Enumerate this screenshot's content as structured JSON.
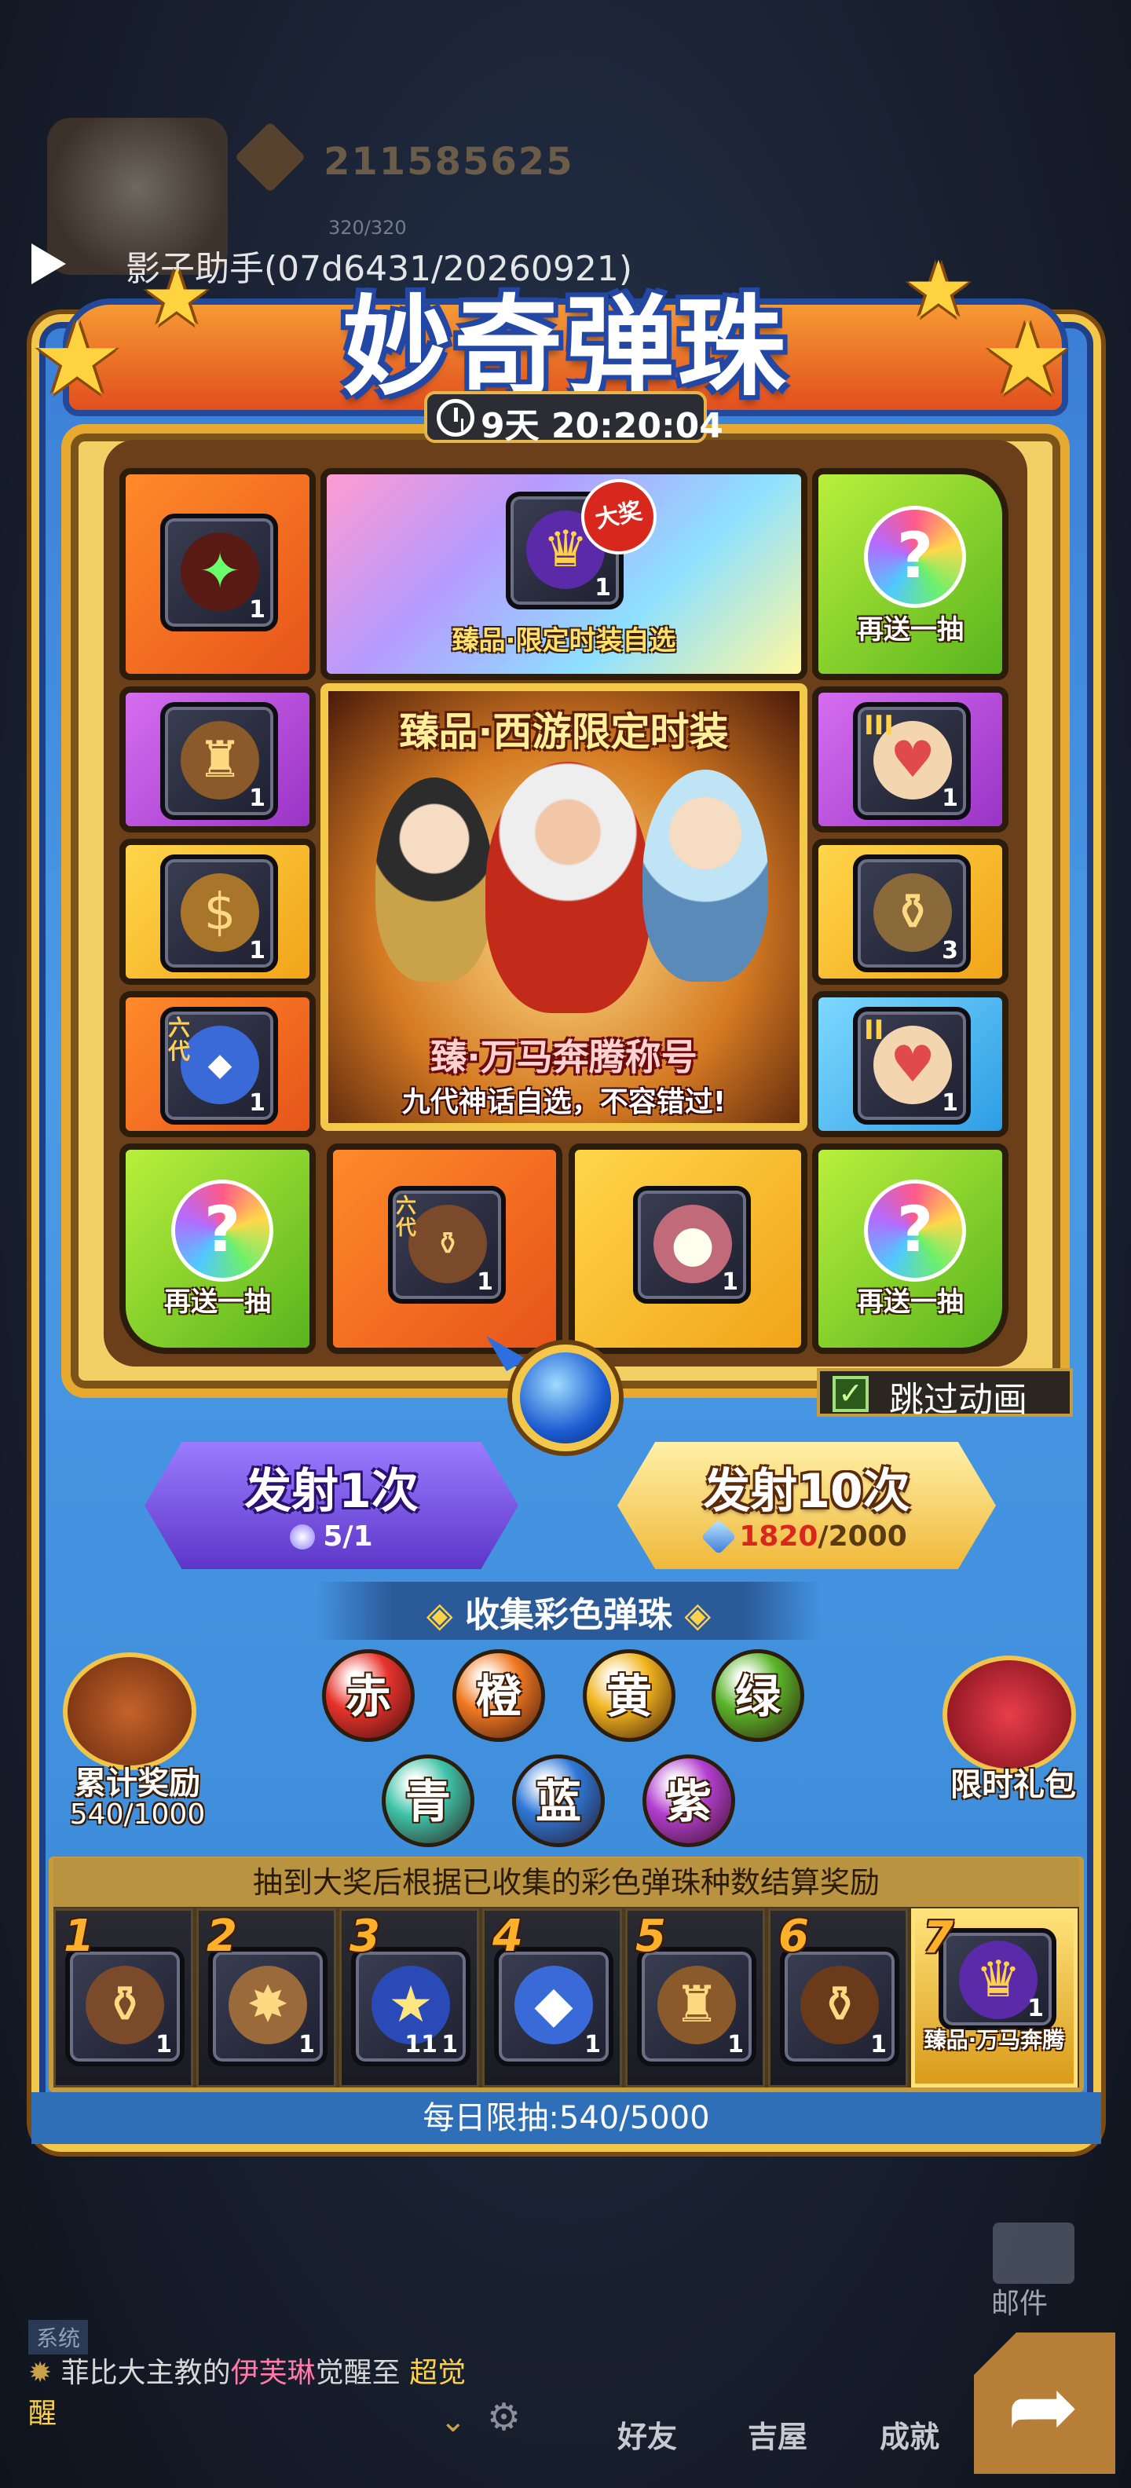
{
  "top": {
    "power_value": "211585625",
    "stamina": "320/320",
    "assistant_text": "影子助手(07d6431/20260921)"
  },
  "event": {
    "title": "妙奇弹珠",
    "timer": "9天 20:20:04"
  },
  "board": {
    "top_center_label": "臻品·限定时装自选",
    "big_prize_tag": "大奖",
    "extra_draw_label": "再送一抽",
    "showcase_title": "臻品·西游限定时装",
    "showcase_sub1": "臻·万马奔腾称号",
    "showcase_sub2": "九代神话自选，不容错过!",
    "tiles": [
      {
        "qty": "1",
        "icon": "relic-icon"
      },
      {
        "qty": "1",
        "icon": "mask-chest-icon"
      },
      {
        "qty": "1",
        "icon": "gold-bag-icon"
      },
      {
        "qty": "1",
        "icon": "gem-scroll-icon",
        "tag": "六代"
      },
      {
        "qty": "1",
        "icon": "pet-egg-icon",
        "tag": "III"
      },
      {
        "qty": "3",
        "icon": "urn-icon"
      },
      {
        "qty": "1",
        "icon": "pet-egg-icon",
        "tag": "II"
      },
      {
        "qty": "1",
        "icon": "select-urn-icon",
        "tag": "六代"
      },
      {
        "qty": "1",
        "icon": "meat-icon"
      },
      {
        "qty": "1",
        "icon": "costume-chest-icon"
      }
    ]
  },
  "controls": {
    "skip_label": "跳过动画",
    "skip_checked": true
  },
  "draw": {
    "single": {
      "label": "发射1次",
      "cost": "5/1"
    },
    "ten": {
      "label": "发射10次",
      "cost_have": "1820",
      "cost_need": "/2000"
    }
  },
  "collect": {
    "title": "收集彩色弹珠",
    "marbles": [
      {
        "char": "赤",
        "color": "#e8332c"
      },
      {
        "char": "橙",
        "color": "#f07a22"
      },
      {
        "char": "黄",
        "color": "#f0b41e"
      },
      {
        "char": "绿",
        "color": "#5ab52a"
      },
      {
        "char": "青",
        "color": "#3ec3a8"
      },
      {
        "char": "蓝",
        "color": "#2d78d8"
      },
      {
        "char": "紫",
        "color": "#b23fd0"
      }
    ]
  },
  "accumulate": {
    "label": "累计奖励",
    "value": "540/1000"
  },
  "gift": {
    "label": "限时礼包"
  },
  "rewards": {
    "header": "抽到大奖后根据已收集的彩色弹珠种数结算奖励",
    "items": [
      {
        "num": "1",
        "qty": "1",
        "icon": "select-urn-icon"
      },
      {
        "num": "2",
        "qty": "1",
        "icon": "level-pack-icon"
      },
      {
        "num": "3",
        "qty": "1",
        "icon": "scroll-icon",
        "extra": "11"
      },
      {
        "num": "4",
        "qty": "1",
        "icon": "gem-scroll-icon"
      },
      {
        "num": "5",
        "qty": "1",
        "icon": "mask-chest-icon"
      },
      {
        "num": "6",
        "qty": "1",
        "icon": "myth-urn-icon"
      },
      {
        "num": "7",
        "qty": "1",
        "icon": "title-badge-icon",
        "label": "臻品·万马奔腾"
      }
    ]
  },
  "daily": {
    "text": "每日限抽:540/5000"
  },
  "hud": {
    "mail": "邮件",
    "friends": "好友",
    "house": "吉屋",
    "achievement": "成就",
    "sys_tag": "系统",
    "sys_msg_pre": "菲比大主教的",
    "sys_msg_name": "伊芙琳",
    "sys_msg_mid": "觉醒至",
    "sys_msg_end": "超觉醒"
  }
}
